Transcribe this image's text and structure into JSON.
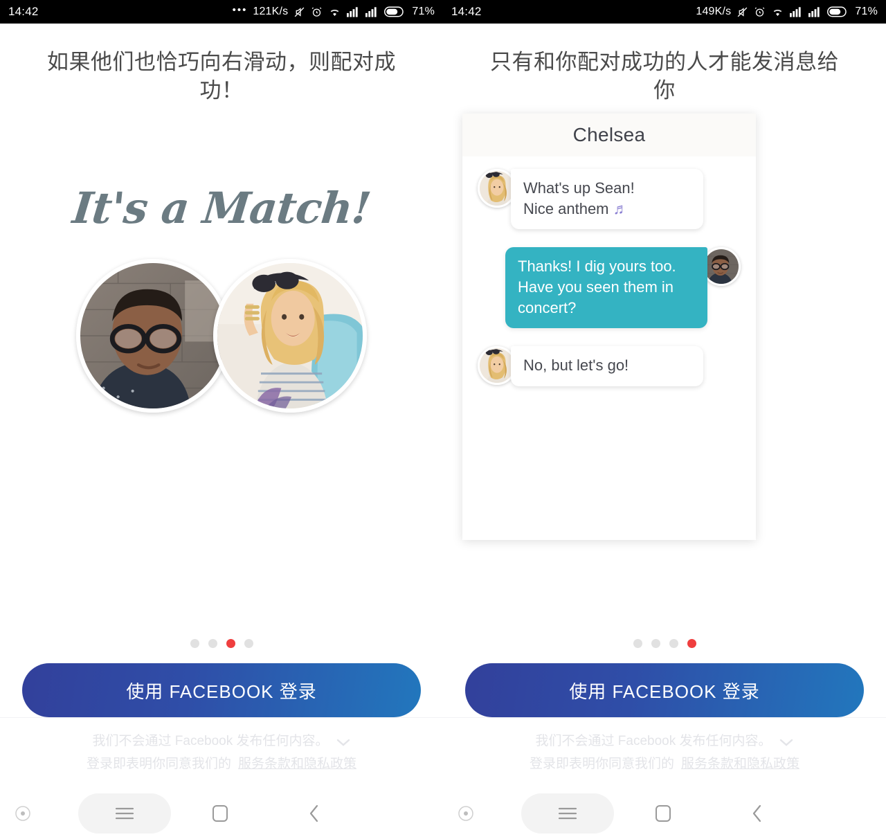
{
  "statusbar": {
    "left": {
      "clock": "14:42",
      "overflow_dots": "•••",
      "net_speed": "121K/s",
      "battery_pct": "71%",
      "icons": [
        "mute-icon",
        "alarm-icon",
        "wifi-icon",
        "signal-sim1-icon",
        "signal-sim2-icon",
        "battery-icon"
      ]
    },
    "right": {
      "clock": "14:42",
      "net_speed": "149K/s",
      "battery_pct": "71%",
      "icons": [
        "mute-icon",
        "alarm-icon",
        "wifi-icon",
        "signal-sim1-icon",
        "signal-sim2-icon",
        "battery-icon"
      ]
    }
  },
  "left_screen": {
    "headline": "如果他们也恰巧向右滑动，则配对成功！",
    "match_script": "It's a Match!",
    "photo_left_alt": "man-with-glasses-photo",
    "photo_right_alt": "woman-with-sunglasses-photo",
    "dots": {
      "count": 4,
      "active_index": 2
    },
    "fb_button": "使用 FACEBOOK 登录",
    "footer": {
      "line1": "我们不会通过 Facebook 发布任何内容。",
      "line2_prefix": "登录即表明你同意我们的",
      "terms_link": "服务条款",
      "and": "和",
      "privacy_link": "隐私政策",
      "chevron": "chevron-down-icon"
    },
    "navbar": {
      "assist": "assistant-dot-icon",
      "menu": "hamburger-menu-icon",
      "home": "home-square-icon",
      "back": "back-chevron-icon"
    }
  },
  "right_screen": {
    "headline": "只有和你配对成功的人才能发消息给你",
    "chat": {
      "title": "Chelsea",
      "messages": [
        {
          "from": "them",
          "avatar": "chelsea-avatar",
          "text": "What's up Sean!\nNice anthem ",
          "emoji": "♬",
          "emoji_name": "music-note-icon"
        },
        {
          "from": "me",
          "avatar": "sean-avatar",
          "text": "Thanks! I dig yours too. Have you seen them in concert?"
        },
        {
          "from": "them",
          "avatar": "chelsea-avatar",
          "text": "No, but let's go!"
        }
      ]
    },
    "dots": {
      "count": 4,
      "active_index": 3
    },
    "fb_button": "使用 FACEBOOK 登录",
    "footer": {
      "line1": "我们不会通过 Facebook 发布任何内容。",
      "line2_prefix": "登录即表明你同意我们的",
      "terms_link": "服务条款",
      "and": "和",
      "privacy_link": "隐私政策",
      "chevron": "chevron-down-icon"
    },
    "navbar": {
      "assist": "assistant-dot-icon",
      "menu": "hamburger-menu-icon",
      "home": "home-square-icon",
      "back": "back-chevron-icon"
    }
  },
  "colors": {
    "accent_dot": "#ef3e3e",
    "bubble_teal": "#34b3c2",
    "fb_gradient_start": "#32409b",
    "fb_gradient_end": "#2277bd",
    "script_gray": "#6b7b82",
    "music_note_purple": "#8a7fd2"
  }
}
